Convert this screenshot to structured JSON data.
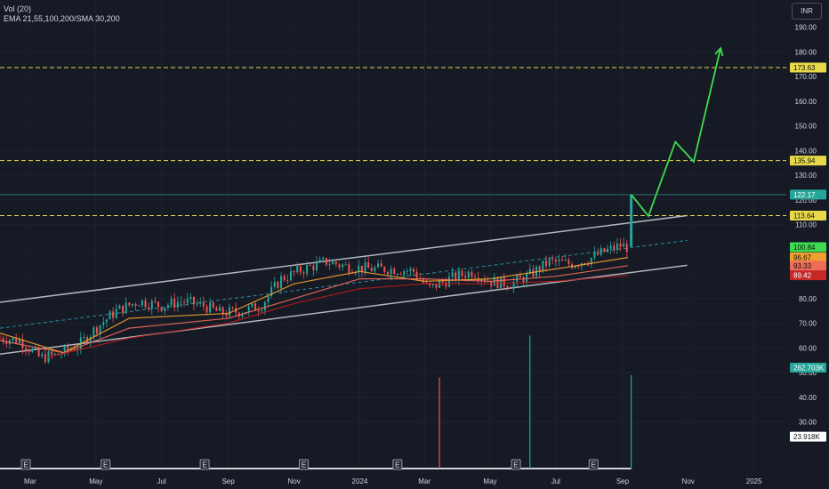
{
  "legend": {
    "volume": "Vol (20)",
    "ema": "EMA 21,55,100,200/SMA 30,200"
  },
  "currency": "INR",
  "colors": {
    "background": "#161a25",
    "grid": "#1e222d",
    "axis_text": "#d1d4dc",
    "up": "#26a69a",
    "down": "#ef5350",
    "channel": "#b2b5be",
    "channel_mid": "#2a8ea0",
    "dashed_level": "#e8d84a",
    "projection": "#3ddc4f",
    "ema_fast": "#ef6c57",
    "ema_mid": "#f0a030",
    "ema_slow": "#b71c1c",
    "volume": "#26a69a"
  },
  "chart_data": {
    "type": "candlestick",
    "instrument_currency": "INR",
    "y_axis": {
      "range": [
        10.0,
        196.0
      ],
      "ticks": [
        "190.00",
        "180.00",
        "170.00",
        "160.00",
        "150.00",
        "140.00",
        "130.00",
        "120.00",
        "110.00",
        "100.00",
        "90.00",
        "80.00",
        "70.00",
        "60.00",
        "50.00",
        "40.00",
        "30.00"
      ]
    },
    "x_axis": {
      "range": [
        "2023-02-01",
        "2025-01-31"
      ],
      "ticks": [
        {
          "label": "Mar",
          "date": "2023-03-01"
        },
        {
          "label": "May",
          "date": "2023-05-01"
        },
        {
          "label": "Jul",
          "date": "2023-07-01"
        },
        {
          "label": "Sep",
          "date": "2023-09-01"
        },
        {
          "label": "Nov",
          "date": "2023-11-01"
        },
        {
          "label": "2024",
          "date": "2024-01-01"
        },
        {
          "label": "Mar",
          "date": "2024-03-01"
        },
        {
          "label": "May",
          "date": "2024-05-01"
        },
        {
          "label": "Jul",
          "date": "2024-07-01"
        },
        {
          "label": "Sep",
          "date": "2024-09-01"
        },
        {
          "label": "Nov",
          "date": "2024-11-01"
        },
        {
          "label": "2025",
          "date": "2025-01-01"
        }
      ]
    },
    "price_path": [
      [
        "2023-02-01",
        64
      ],
      [
        "2023-02-20",
        63
      ],
      [
        "2023-03-10",
        56
      ],
      [
        "2023-03-25",
        57
      ],
      [
        "2023-04-15",
        61
      ],
      [
        "2023-05-01",
        68
      ],
      [
        "2023-05-20",
        75
      ],
      [
        "2023-06-10",
        79
      ],
      [
        "2023-07-01",
        77
      ],
      [
        "2023-07-20",
        79
      ],
      [
        "2023-08-10",
        77
      ],
      [
        "2023-08-25",
        74
      ],
      [
        "2023-09-15",
        75
      ],
      [
        "2023-10-01",
        77
      ],
      [
        "2023-10-20",
        88
      ],
      [
        "2023-11-10",
        92
      ],
      [
        "2023-12-01",
        95
      ],
      [
        "2023-12-20",
        93
      ],
      [
        "2024-01-10",
        92
      ],
      [
        "2024-02-01",
        92
      ],
      [
        "2024-02-20",
        91
      ],
      [
        "2024-03-05",
        84
      ],
      [
        "2024-03-25",
        88
      ],
      [
        "2024-04-15",
        91
      ],
      [
        "2024-05-01",
        87
      ],
      [
        "2024-05-20",
        86
      ],
      [
        "2024-06-05",
        89
      ],
      [
        "2024-06-25",
        95
      ],
      [
        "2024-07-15",
        94
      ],
      [
        "2024-08-01",
        96
      ],
      [
        "2024-08-15",
        99
      ],
      [
        "2024-08-30",
        101.5
      ],
      [
        "2024-09-06",
        100.8
      ]
    ],
    "breakout_candle": {
      "date": "2024-09-09",
      "open": 101,
      "close": 122.17,
      "high": 122.17,
      "low": 100.5
    },
    "ema_lines": [
      {
        "points": [
          [
            "2023-02-01",
            66
          ],
          [
            "2023-04-01",
            58
          ],
          [
            "2023-06-01",
            72
          ],
          [
            "2023-09-01",
            74
          ],
          [
            "2023-11-01",
            86
          ],
          [
            "2024-01-01",
            91
          ],
          [
            "2024-03-01",
            87
          ],
          [
            "2024-05-01",
            88
          ],
          [
            "2024-07-01",
            92
          ],
          [
            "2024-09-06",
            96.67
          ]
        ]
      },
      {
        "points": [
          [
            "2023-02-01",
            63
          ],
          [
            "2023-04-01",
            58
          ],
          [
            "2023-06-01",
            68
          ],
          [
            "2023-09-01",
            72
          ],
          [
            "2023-11-01",
            80
          ],
          [
            "2024-01-01",
            88
          ],
          [
            "2024-03-01",
            88
          ],
          [
            "2024-05-01",
            87
          ],
          [
            "2024-07-01",
            89
          ],
          [
            "2024-09-06",
            93.33
          ]
        ]
      },
      {
        "points": [
          [
            "2023-03-15",
            56
          ],
          [
            "2023-06-01",
            64
          ],
          [
            "2023-09-01",
            70
          ],
          [
            "2023-11-01",
            78
          ],
          [
            "2024-01-01",
            84
          ],
          [
            "2024-03-01",
            86
          ],
          [
            "2024-05-01",
            86
          ],
          [
            "2024-07-01",
            87
          ],
          [
            "2024-09-06",
            89.42
          ]
        ]
      }
    ],
    "channel": {
      "upper": [
        [
          "2023-02-01",
          78.5
        ],
        [
          "2024-10-31",
          113.64
        ]
      ],
      "lower": [
        [
          "2023-02-01",
          57.5
        ],
        [
          "2024-10-31",
          93.5
        ]
      ],
      "mid": [
        [
          "2023-02-01",
          68
        ],
        [
          "2024-10-31",
          103.6
        ]
      ]
    },
    "horizontal_levels": [
      {
        "value": 173.63,
        "style": "dashed"
      },
      {
        "value": 135.94,
        "style": "dashed"
      },
      {
        "value": 122.17,
        "style": "solid"
      },
      {
        "value": 113.64,
        "style": "dashed"
      }
    ],
    "projection_path": [
      [
        "2024-09-09",
        122.17
      ],
      [
        "2024-09-25",
        113.5
      ],
      [
        "2024-10-20",
        143.5
      ],
      [
        "2024-11-06",
        135.5
      ],
      [
        "2024-12-01",
        181.5
      ]
    ],
    "price_labels": [
      {
        "text": "173.63",
        "value": 173.63,
        "bg": "#e8d84a",
        "fg": "#111"
      },
      {
        "text": "135.94",
        "value": 135.94,
        "bg": "#e8d84a",
        "fg": "#111"
      },
      {
        "text": "122.17",
        "value": 122.17,
        "bg": "#26a69a",
        "fg": "#fff"
      },
      {
        "text": "113.64",
        "value": 113.64,
        "bg": "#e8d84a",
        "fg": "#111"
      },
      {
        "text": "100.84",
        "value": 100.84,
        "bg": "#3ddc4f",
        "fg": "#111"
      },
      {
        "text": "96.67",
        "value": 96.67,
        "bg": "#f0a030",
        "fg": "#111"
      },
      {
        "text": "93.33",
        "value": 93.33,
        "bg": "#ef6c57",
        "fg": "#111"
      },
      {
        "text": "89.42",
        "value": 89.42,
        "bg": "#c62828",
        "fg": "#fff"
      },
      {
        "text": "262.703K",
        "value": 52.0,
        "bg": "#26a69a",
        "fg": "#fff"
      },
      {
        "text": "23.918K",
        "value": 24.0,
        "bg": "#ffffff",
        "fg": "#111"
      }
    ],
    "volume_spikes": [
      {
        "date": "2024-03-15",
        "value": 48
      },
      {
        "date": "2024-06-07",
        "value": 65
      },
      {
        "date": "2024-09-09",
        "value": 49
      }
    ],
    "event_markers": {
      "label": "E",
      "dates": [
        "2023-02-25",
        "2023-05-10",
        "2023-08-10",
        "2023-11-10",
        "2024-02-05",
        "2024-05-25",
        "2024-08-05"
      ]
    }
  }
}
